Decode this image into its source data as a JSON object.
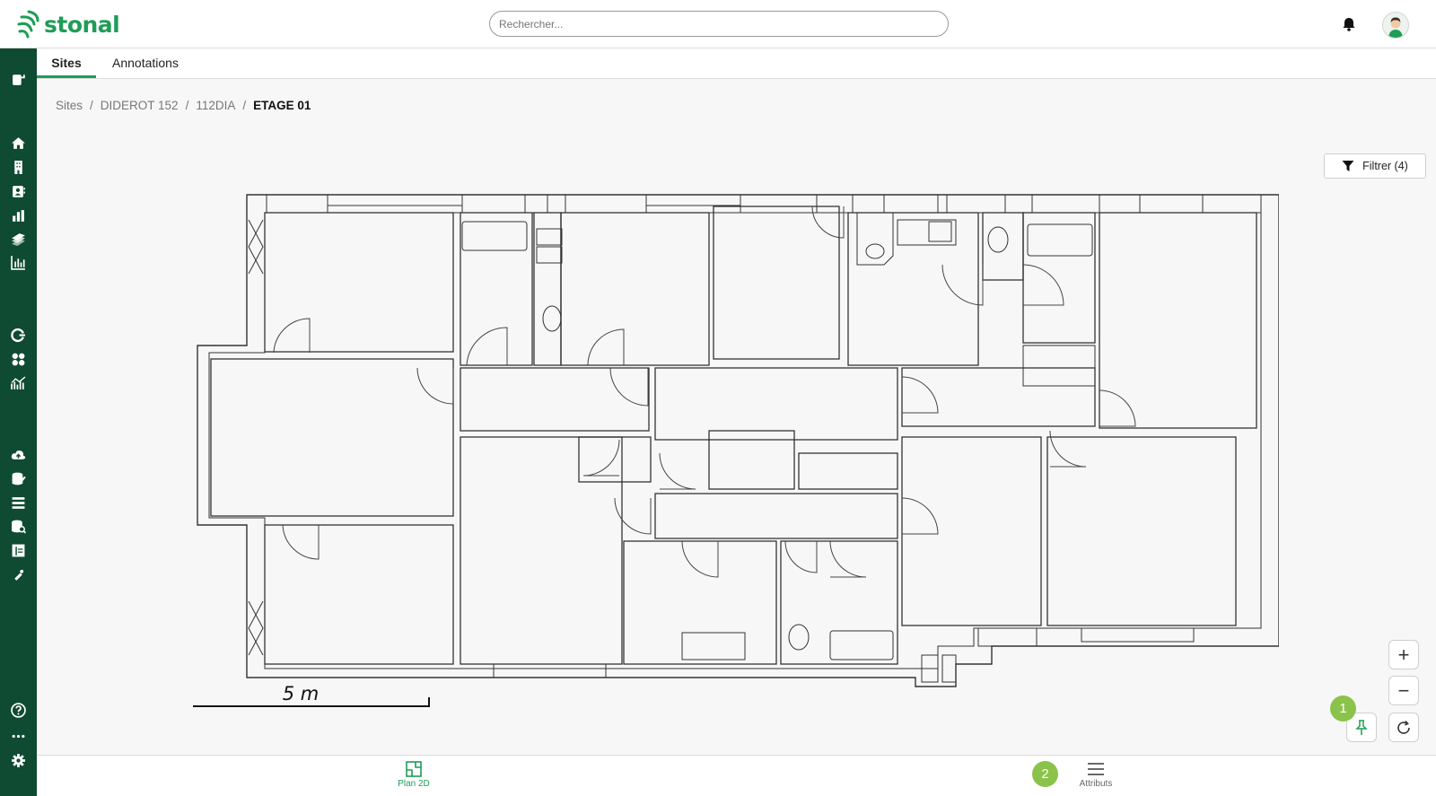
{
  "app": {
    "name": "stonal",
    "brand_color": "#1f9d57",
    "sidebar_color": "#0f4a33"
  },
  "header": {
    "search_placeholder": "Rechercher...",
    "icons": [
      "bell-icon",
      "user-avatar"
    ]
  },
  "tabs": [
    {
      "label": "Sites",
      "active": true
    },
    {
      "label": "Annotations",
      "active": false
    }
  ],
  "breadcrumb": [
    "Sites",
    "DIDEROT 152",
    "112DIA",
    "ETAGE 01"
  ],
  "filter": {
    "label": "Filtrer (4)"
  },
  "plan": {
    "scale_label": "5 m"
  },
  "sidebar_icons": [
    "toggle-panel-icon",
    "home-icon",
    "building-icon",
    "contacts-icon",
    "bar-chart-icon",
    "layers-icon",
    "analytics-icon",
    "refresh-icon",
    "apps-icon",
    "trend-chart-icon",
    "cloud-upload-icon",
    "database-edit-icon",
    "list-icon",
    "database-search-icon",
    "layout-icon",
    "pen-icon",
    "help-icon",
    "more-icon",
    "settings-icon"
  ],
  "controls": {
    "zoom_in": "+",
    "zoom_out": "−",
    "badge_1": "1",
    "badge_2": "2"
  },
  "bottom": {
    "plan_label": "Plan 2D",
    "attributes_label": "Attributs"
  }
}
